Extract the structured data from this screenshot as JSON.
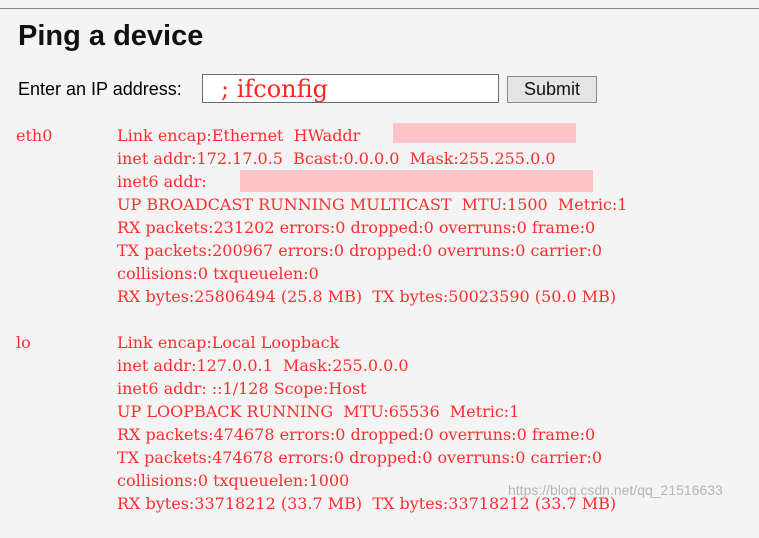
{
  "page": {
    "title": "Ping a device"
  },
  "form": {
    "label": "Enter an IP address:",
    "input_value": "; ifconfig",
    "submit_label": "Submit"
  },
  "output": {
    "interfaces": [
      {
        "name": "eth0",
        "lines": [
          "Link encap:Ethernet  HWaddr ",
          "inet addr:172.17.0.5  Bcast:0.0.0.0  Mask:255.255.0.0",
          "inet6 addr: ",
          "UP BROADCAST RUNNING MULTICAST  MTU:1500  Metric:1",
          "RX packets:231202 errors:0 dropped:0 overruns:0 frame:0",
          "TX packets:200967 errors:0 dropped:0 overruns:0 carrier:0",
          "collisions:0 txqueuelen:0",
          "RX bytes:25806494 (25.8 MB)  TX bytes:50023590 (50.0 MB)"
        ]
      },
      {
        "name": "lo",
        "lines": [
          "Link encap:Local Loopback",
          "inet addr:127.0.0.1  Mask:255.0.0.0",
          "inet6 addr: ::1/128 Scope:Host",
          "UP LOOPBACK RUNNING  MTU:65536  Metric:1",
          "RX packets:474678 errors:0 dropped:0 overruns:0 frame:0",
          "TX packets:474678 errors:0 dropped:0 overruns:0 carrier:0",
          "collisions:0 txqueuelen:1000",
          "RX bytes:33718212 (33.7 MB)  TX bytes:33718212 (33.7 MB)"
        ]
      }
    ]
  },
  "watermark": {
    "text": "https://blog.csdn.net/qq_21516633"
  },
  "colors": {
    "background": "#f4f4f4",
    "output_text": "#ff2d2d",
    "redaction": "#ffc4c8"
  }
}
